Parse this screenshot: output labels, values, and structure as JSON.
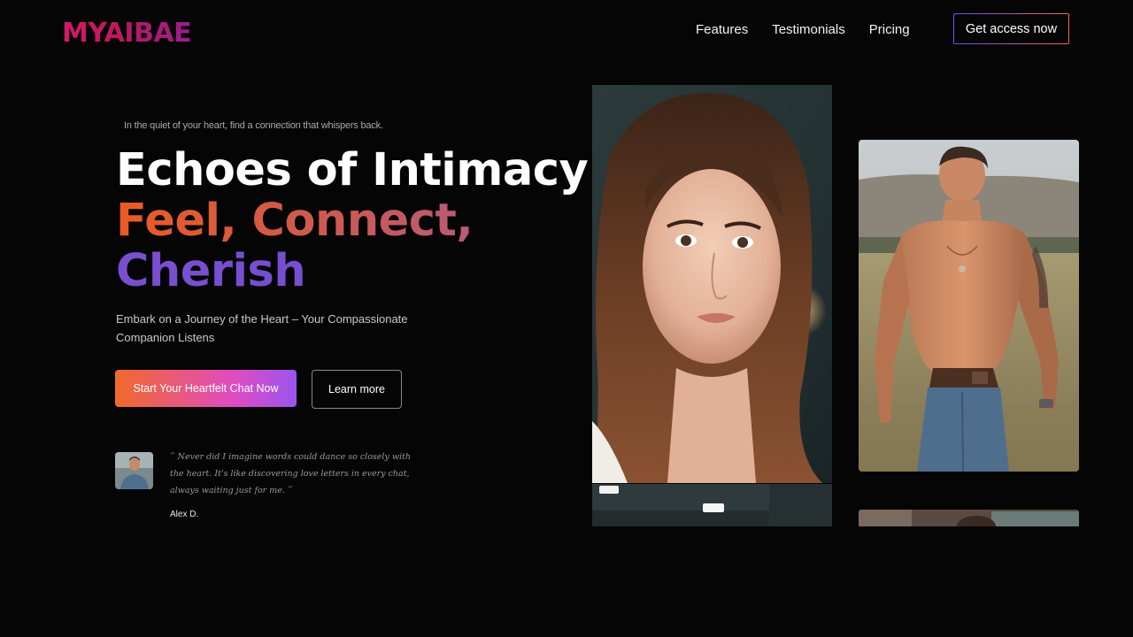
{
  "brand": {
    "logo": "MYAIBAE"
  },
  "nav": {
    "items": [
      "Features",
      "Testimonials",
      "Pricing"
    ],
    "cta": "Get access now"
  },
  "hero": {
    "tagline": "In the quiet of your heart, find a connection that whispers back.",
    "headline_line1": "Echoes of Intimacy:",
    "headline_line2": "Feel, Connect,",
    "headline_line3": "Cherish",
    "subtitle": "Embark on a Journey of the Heart – Your Compassionate Companion Listens",
    "primary_button": "Start Your Heartfelt Chat Now",
    "secondary_button": "Learn more"
  },
  "testimonial": {
    "open_quote": "“",
    "text": "Never did I imagine words could dance so closely with the heart. It's like discovering love letters in every chat, always waiting just for me.",
    "close_quote": "”",
    "author": "Alex D."
  },
  "colors": {
    "background": "#050505",
    "logo_gradient": [
      "#d6186b",
      "#9b1d8c"
    ],
    "button_gradient": [
      "#f06a2a",
      "#e04cc0",
      "#9a55ef"
    ],
    "headline_accent": [
      "#ea5b22",
      "#7a4fce"
    ]
  },
  "images": {
    "card_1": "portrait-woman-photo",
    "card_2": "shirtless-man-field-photo",
    "card_3": "partial-photo",
    "card_4": "partial-photo",
    "avatar": "testimonial-avatar-photo"
  }
}
